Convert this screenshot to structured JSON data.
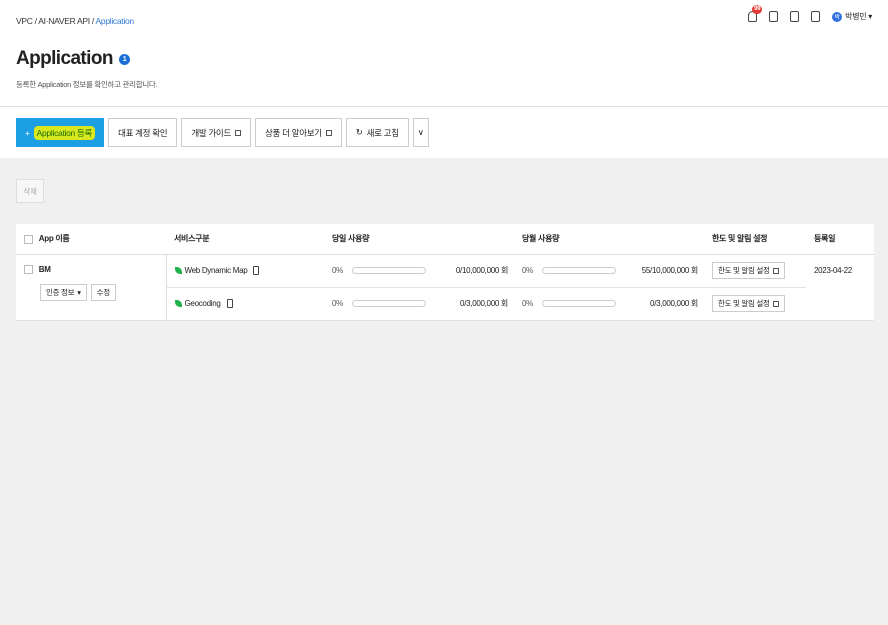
{
  "breadcrumb": {
    "parts": [
      "VPC",
      "AI·NAVER API"
    ],
    "sep": "/",
    "current": "Application"
  },
  "header_icons": {
    "notification_count": "99",
    "user_initial": "박",
    "user_name": "박병민 ▾"
  },
  "page": {
    "title": "Application",
    "info_badge": "1",
    "description": "등록한 Application 정보를 확인하고 관리합니다."
  },
  "toolbar": {
    "register": "Application 등록",
    "register_prefix": "+",
    "main_account": "대표 계정 확인",
    "dev_guide": "개발 가이드",
    "product_more": "상품 더 알아보기",
    "refresh": "새로 고침",
    "refresh_icon": "↻",
    "more": "∨"
  },
  "delete_label": "삭제",
  "table": {
    "headers": {
      "app_name": "App 이름",
      "service": "서비스구분",
      "daily": "당일 사용량",
      "monthly": "당월 사용량",
      "limit": "한도 및 알림 설정",
      "reg_date": "등록일"
    },
    "app": {
      "name": "BM",
      "auth_btn": "인증 정보",
      "edit_btn": "수정",
      "reg_date": "2023-04-22"
    },
    "rows": [
      {
        "service": "Web Dynamic Map",
        "daily_pct": "0%",
        "daily_fill": 0,
        "daily_count": "0/10,000,000 회",
        "monthly_pct": "0%",
        "monthly_fill": 0.0,
        "monthly_count": "55/10,000,000 회",
        "limit_btn": "한도 및 알림 설정"
      },
      {
        "service": "Geocoding",
        "daily_pct": "0%",
        "daily_fill": 0,
        "daily_count": "0/3,000,000 회",
        "monthly_pct": "0%",
        "monthly_fill": 0,
        "monthly_count": "0/3,000,000 회",
        "limit_btn": "한도 및 알림 설정"
      }
    ]
  },
  "colors": {
    "accent": "#1ca0e3",
    "highlight": "#d8e81c",
    "badge": "#e53935"
  }
}
